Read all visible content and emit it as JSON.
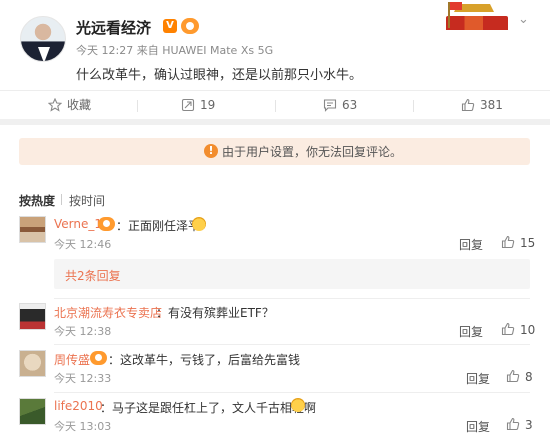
{
  "post": {
    "author": "光远看经济",
    "verified_badge": "V",
    "time": "今天 12:27",
    "source": "来自 HUAWEI Mate Xs 5G",
    "text": "什么改革牛，确认过眼神，还是以前那只小水牛。",
    "menu_icon": "chevron-down-icon"
  },
  "actions": {
    "favorite_label": "收藏",
    "repost_count": "19",
    "comment_count": "63",
    "like_count": "381"
  },
  "comments_section": {
    "notice_icon": "!",
    "notice": "由于用户设置，你无法回复评论。",
    "sort_hot": "按热度",
    "sort_time": "按时间"
  },
  "comments": [
    {
      "name": "Verne_1",
      "text": "：正面刚任泽平",
      "time": "今天 12:46",
      "reply": "回复",
      "likes": "15",
      "has_badge": true,
      "emoji": "laughing-crying-emoji"
    },
    {
      "name": "北京潮流寿衣专卖店",
      "text": "：有没有殡葬业ETF？",
      "time": "今天 12:38",
      "reply": "回复",
      "likes": "10",
      "has_badge": false
    },
    {
      "name": "周传盛",
      "text": "：这改革牛，亏钱了，后富给先富钱",
      "time": "今天 12:33",
      "reply": "回复",
      "likes": "8",
      "has_badge": true
    },
    {
      "name": "life2010",
      "text": "：马子这是跟任杠上了，文人千古相轻啊",
      "time": "今天 13:03",
      "reply": "回复",
      "likes": "3",
      "has_badge": false,
      "emoji": "grinning-emoji"
    }
  ],
  "sub_replies_label": "共2条回复",
  "colors": {
    "accent": "#eb7350",
    "brand_orange": "#ff8200",
    "notice_bg": "#fbece1"
  }
}
